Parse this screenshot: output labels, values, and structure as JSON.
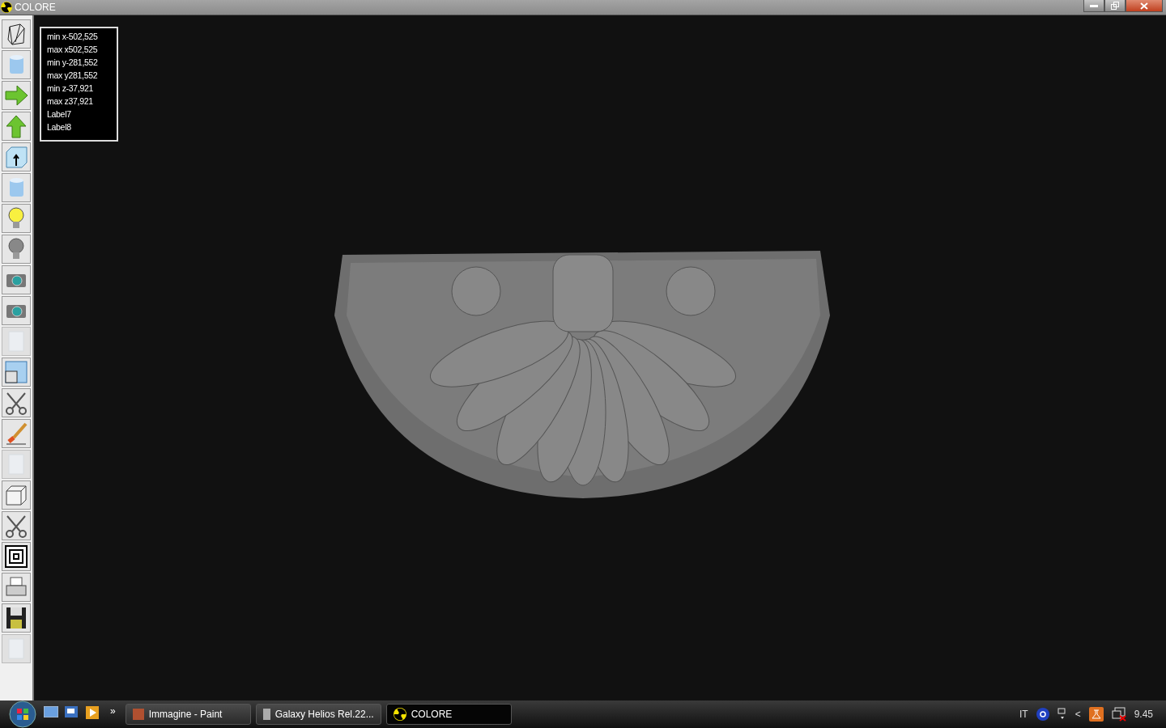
{
  "window": {
    "title": "COLORE"
  },
  "tools": [
    {
      "kind": "wireframe",
      "disabled": false
    },
    {
      "kind": "cylinder",
      "disabled": false
    },
    {
      "kind": "arrow-right",
      "disabled": false
    },
    {
      "kind": "arrow-up",
      "disabled": false
    },
    {
      "kind": "box-arrow",
      "disabled": false
    },
    {
      "kind": "cylinder",
      "disabled": false
    },
    {
      "kind": "bulb-on",
      "disabled": false
    },
    {
      "kind": "bulb-off",
      "disabled": false
    },
    {
      "kind": "camera",
      "disabled": false
    },
    {
      "kind": "camera",
      "disabled": false
    },
    {
      "kind": "texture",
      "disabled": true
    },
    {
      "kind": "windows",
      "disabled": false
    },
    {
      "kind": "scissors",
      "disabled": false
    },
    {
      "kind": "brush",
      "disabled": false
    },
    {
      "kind": "texture",
      "disabled": true
    },
    {
      "kind": "cube",
      "disabled": false
    },
    {
      "kind": "scissors",
      "disabled": false
    },
    {
      "kind": "squares",
      "disabled": false
    },
    {
      "kind": "printer",
      "disabled": false
    },
    {
      "kind": "floppy",
      "disabled": false
    },
    {
      "kind": "texture",
      "disabled": true
    }
  ],
  "info_lines": [
    "min x-502,525",
    "max x502,525",
    "min y-281,552",
    "max y281,552",
    "min z-37,921",
    "max z37,921",
    "Label7",
    "Label8"
  ],
  "taskbar": {
    "more": "»",
    "tasks": [
      {
        "label": "Immagine - Paint",
        "selected": false
      },
      {
        "label": "Galaxy Helios  Rel.22...",
        "selected": false
      },
      {
        "label": "COLORE",
        "selected": true
      }
    ],
    "language": "IT",
    "tray_arrow": "<",
    "clock": "9.45"
  }
}
